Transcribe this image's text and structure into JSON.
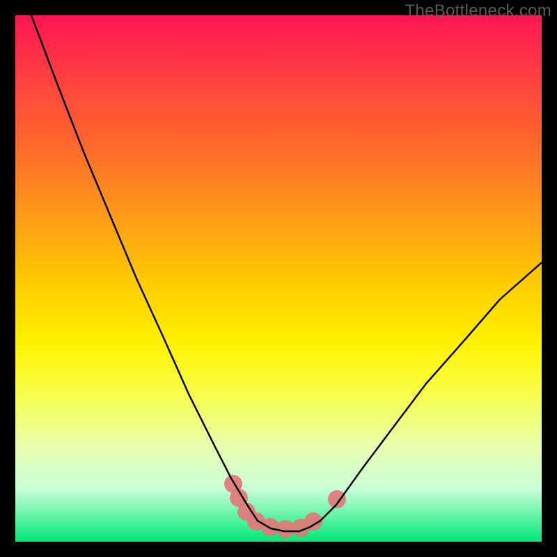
{
  "watermark": "TheBottleneck.com",
  "chart_data": {
    "type": "line",
    "title": "",
    "xlabel": "",
    "ylabel": "",
    "xlim": [
      0,
      100
    ],
    "ylim": [
      0,
      100
    ],
    "series": [
      {
        "name": "curve",
        "x": [
          3,
          8,
          13,
          18,
          23,
          28,
          33,
          38,
          41,
          44,
          46,
          48.5,
          51,
          54,
          56,
          58,
          61,
          66,
          72,
          78,
          85,
          92,
          100
        ],
        "y": [
          100,
          87,
          74,
          62,
          50,
          39,
          28,
          18,
          12,
          7,
          4,
          2.5,
          2,
          2,
          2.8,
          4,
          7,
          14,
          22,
          30,
          38,
          46,
          53
        ]
      }
    ],
    "highlight_segments": [
      {
        "name": "trough-band",
        "color": "#e27878",
        "x_range": [
          41,
          62
        ],
        "y_approx": 3
      }
    ],
    "background_gradient": {
      "top": "#ff1452",
      "mid": "#fff200",
      "bottom": "#00e878"
    }
  }
}
